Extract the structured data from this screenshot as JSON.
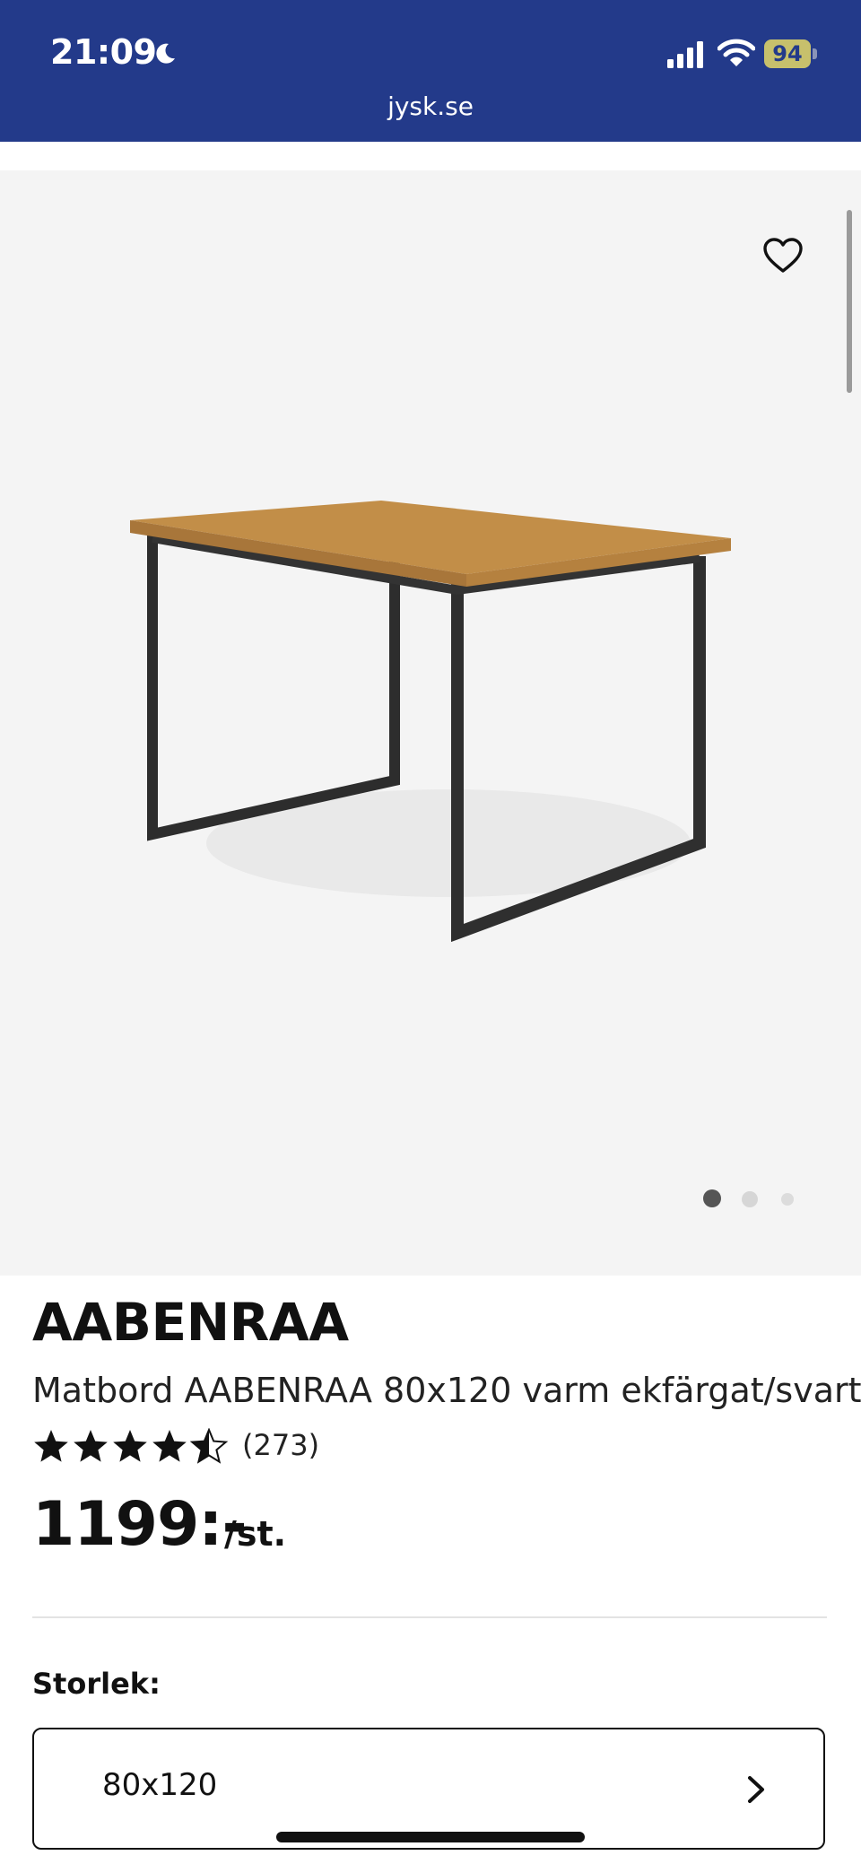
{
  "status_bar": {
    "time": "21:09",
    "battery": "94",
    "url": "jysk.se",
    "icons": [
      "moon-icon",
      "signal-icon",
      "wifi-icon",
      "battery-icon"
    ]
  },
  "gallery": {
    "image_count": 3,
    "active_index": 0,
    "icons": [
      "heart-icon"
    ]
  },
  "product": {
    "brand": "AABENRAA",
    "description": "Matbord AABENRAA 80x120 varm ekfärgat/svart",
    "rating": 4.5,
    "review_count": "(273)",
    "price": "1199:-",
    "unit": "/st."
  },
  "size": {
    "label": "Storlek:",
    "value": "80x120"
  },
  "colors": {
    "status_bar": "#233a8a",
    "gallery_bg": "#f4f4f4",
    "text": "#111111"
  }
}
